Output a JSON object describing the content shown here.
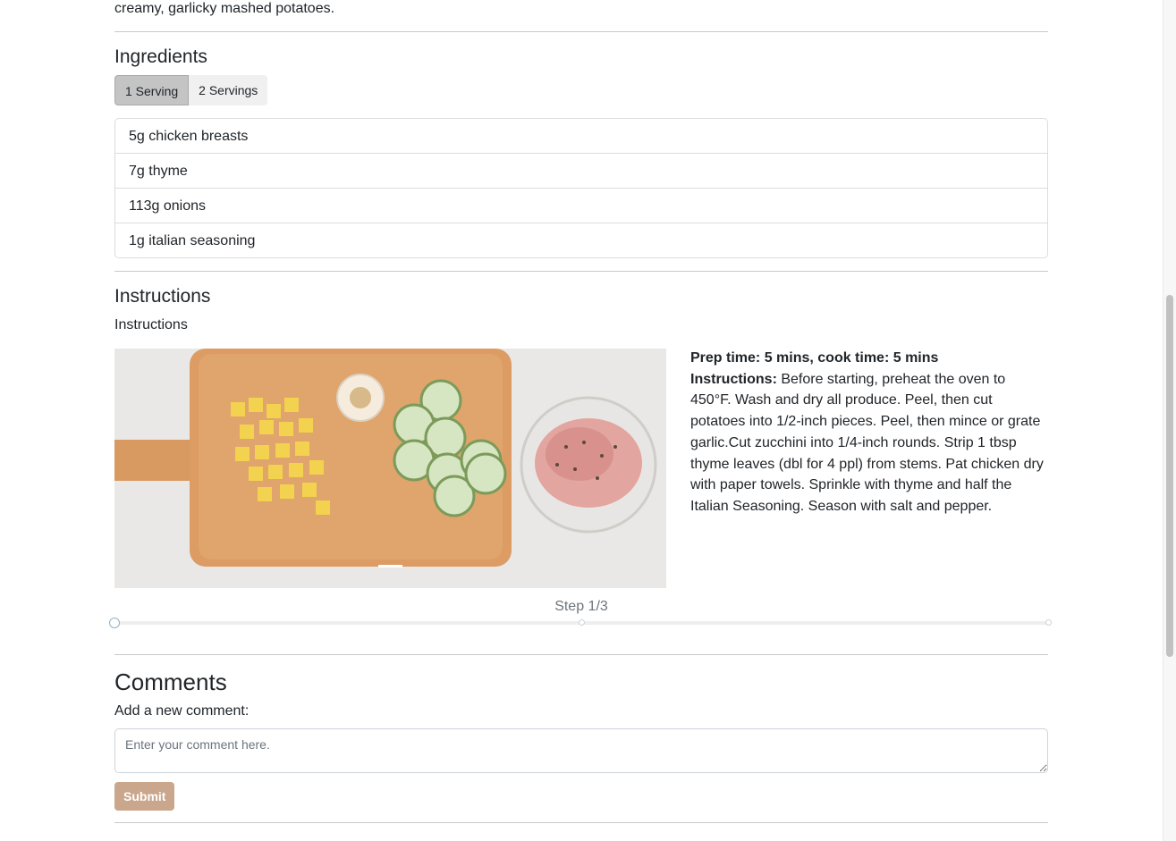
{
  "intro": {
    "text": "creamy, garlicky mashed potatoes."
  },
  "ingredients": {
    "title": "Ingredients",
    "serving_options": [
      "1 Serving",
      "2 Servings"
    ],
    "selected_serving": "1 Serving",
    "items": [
      "5g chicken breasts",
      "7g thyme",
      "113g onions",
      "1g italian seasoning"
    ]
  },
  "instructions": {
    "title": "Instructions",
    "subtitle": "Instructions",
    "step": {
      "time_label": "Prep time: 5 mins, cook time: 5 mins",
      "instructions_label": "Instructions:",
      "instructions_text": "Before starting, preheat the oven to 450°F. Wash and dry all produce. Peel, then cut potatoes into 1/2-inch pieces. Peel, then mince or grate garlic.Cut zucchini into 1/4-inch rounds. Strip 1 tbsp thyme leaves (dbl for 4 ppl) from stems. Pat chicken dry with paper towels. Sprinkle with thyme and half the Italian Seasoning. Season with salt and pepper.",
      "image_alt": "Cutting board with diced potatoes, sliced zucchini, garlic and seasoned chicken"
    },
    "step_label": "Step 1/3",
    "current_step": 1,
    "total_steps": 3
  },
  "comments": {
    "title": "Comments",
    "add_label": "Add a new comment:",
    "placeholder": "Enter your comment here.",
    "submit_label": "Submit"
  },
  "colors": {
    "submit": "#c9a68c",
    "active_serving": "#c4c4c4"
  }
}
